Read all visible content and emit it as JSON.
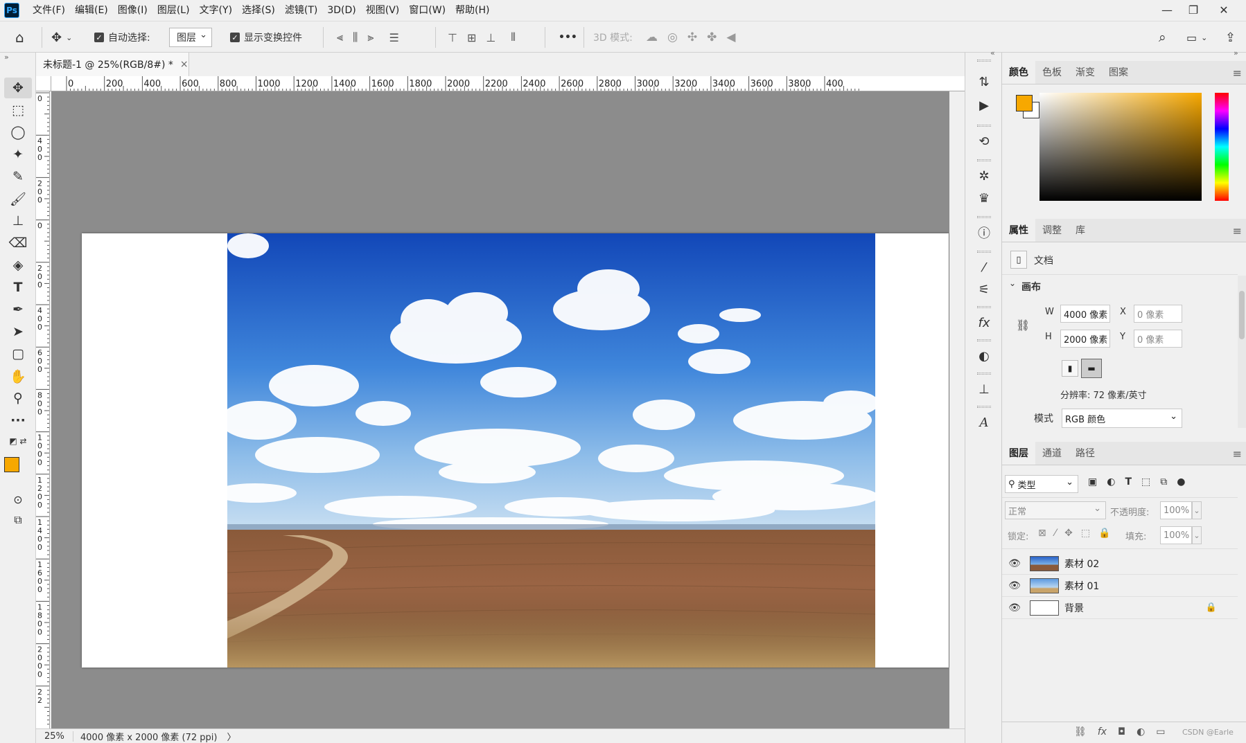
{
  "app": {
    "logo": "Ps"
  },
  "menu": [
    "文件(F)",
    "编辑(E)",
    "图像(I)",
    "图层(L)",
    "文字(Y)",
    "选择(S)",
    "滤镜(T)",
    "3D(D)",
    "视图(V)",
    "窗口(W)",
    "帮助(H)"
  ],
  "window_controls": {
    "minimize": "—",
    "restore": "❐",
    "close": "✕"
  },
  "options": {
    "auto_select_label": "自动选择:",
    "auto_select_value": "图层",
    "show_transform_label": "显示变换控件",
    "more": "•••",
    "mode_3d_label": "3D 模式:"
  },
  "document": {
    "tab_title": "未标题-1 @ 25%(RGB/8#) *",
    "tab_close": "×",
    "ruler_h_labels": [
      "0",
      "200",
      "400",
      "600",
      "800",
      "1000",
      "1200",
      "1400",
      "1600",
      "1800",
      "2000",
      "2200",
      "2400",
      "2600",
      "2800",
      "3000",
      "3200",
      "3400",
      "3600",
      "3800",
      "400"
    ],
    "ruler_v_labels": [
      "0",
      "4\n0\n0",
      "2\n0\n0",
      "0",
      "2\n0\n0",
      "4\n0\n0",
      "6\n0\n0",
      "8\n0\n0",
      "1\n0\n0\n0",
      "1\n2\n0\n0",
      "1\n4\n0\n0",
      "1\n6\n0\n0",
      "1\n8\n0\n0",
      "2\n0\n0\n0",
      "2\n2"
    ],
    "zoom": "25%",
    "status_info": "4000 像素 x 2000 像素 (72 ppi)",
    "status_arrow": "〉"
  },
  "color_panel": {
    "tabs": [
      "颜色",
      "色板",
      "渐变",
      "图案"
    ],
    "foreground": "#f7a800",
    "background": "#ffffff"
  },
  "properties_panel": {
    "tabs": [
      "属性",
      "调整",
      "库"
    ],
    "doc_label": "文档",
    "canvas_label": "画布",
    "w_label": "W",
    "w_value": "4000 像素",
    "h_label": "H",
    "h_value": "2000 像素",
    "x_label": "X",
    "x_value": "0 像素",
    "y_label": "Y",
    "y_value": "0 像素",
    "resolution": "分辨率: 72 像素/英寸",
    "mode_label": "模式",
    "mode_value": "RGB 颜色"
  },
  "layers_panel": {
    "tabs": [
      "图层",
      "通道",
      "路径"
    ],
    "filter_value": "类型",
    "blend_mode": "正常",
    "opacity_label": "不透明度:",
    "opacity_value": "100%",
    "lock_label": "锁定:",
    "fill_label": "填充:",
    "fill_value": "100%",
    "layers": [
      {
        "name": "素材 02"
      },
      {
        "name": "素材 01"
      },
      {
        "name": "背景"
      }
    ],
    "watermark": "CSDN @Earle"
  }
}
